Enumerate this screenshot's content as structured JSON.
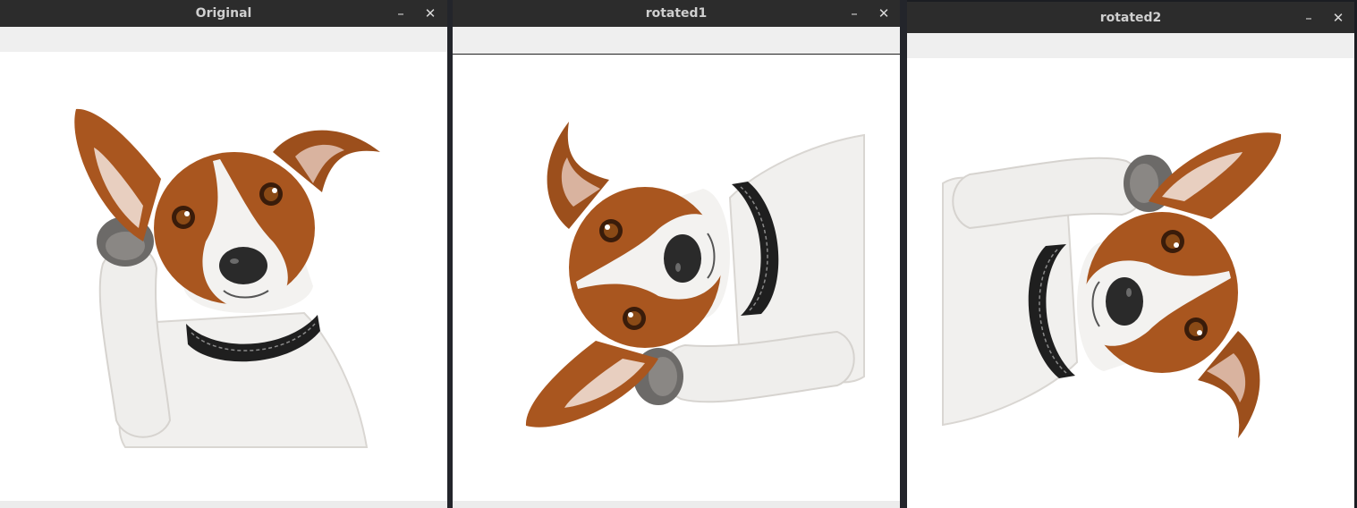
{
  "windows": [
    {
      "title": "Original",
      "minimize_glyph": "–",
      "close_glyph": "✕",
      "image": "dog-upright"
    },
    {
      "title": "rotated1",
      "minimize_glyph": "–",
      "close_glyph": "✕",
      "image": "dog-rotated-clockwise"
    },
    {
      "title": "rotated2",
      "minimize_glyph": "–",
      "close_glyph": "✕",
      "image": "dog-rotated-counterclockwise"
    }
  ],
  "colors": {
    "titlebar": "#2c2c2c",
    "title_text": "#cfcfcf",
    "toolbar": "#efefef",
    "desktop": "#1b1d22",
    "fur_brown": "#a9561f",
    "fur_white": "#f1f0ee",
    "collar": "#1f1f1f"
  }
}
